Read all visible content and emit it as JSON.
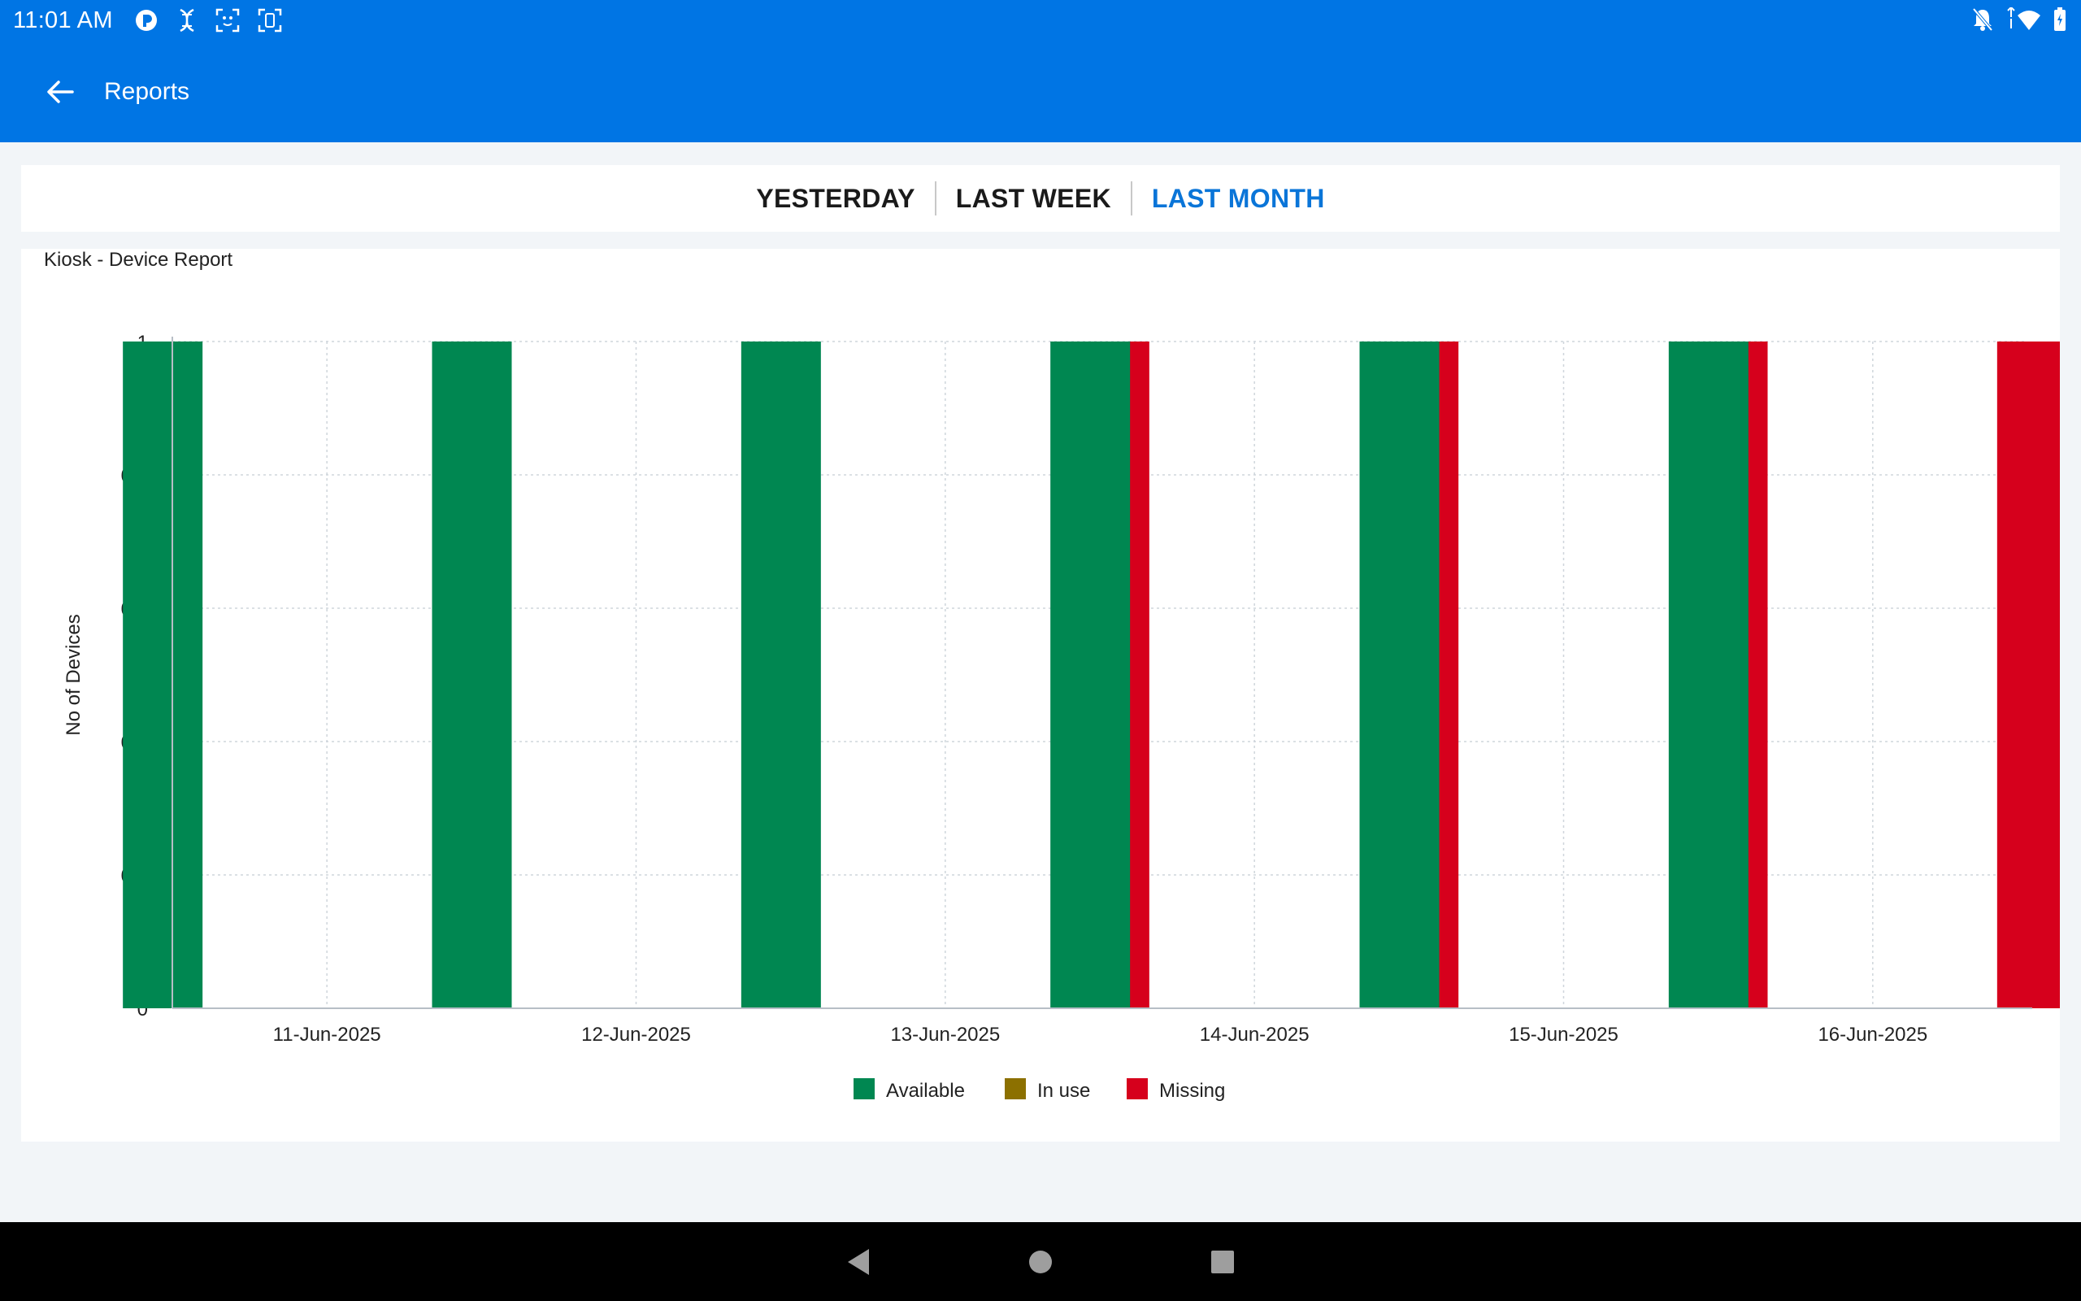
{
  "status_bar": {
    "time": "11:01 AM",
    "left_icons": [
      "app-logo-icon",
      "dna-icon",
      "face-scan-icon",
      "screenshot-icon"
    ],
    "right_icons": [
      "notifications-off-icon",
      "wifi-icon",
      "battery-icon"
    ]
  },
  "app_bar": {
    "title": "Reports",
    "back_icon": "arrow-back-icon"
  },
  "tabs": [
    {
      "label": "YESTERDAY",
      "active": false
    },
    {
      "label": "LAST WEEK",
      "active": false
    },
    {
      "label": "LAST MONTH",
      "active": true
    }
  ],
  "colors": {
    "primary": "#0075e4",
    "available": "#008751",
    "in_use": "#8c7000",
    "missing": "#d6001c"
  },
  "chart_data": {
    "type": "bar",
    "title": "Kiosk - Device Report",
    "xlabel": "",
    "ylabel": "No of Devices",
    "ylim": [
      0,
      1
    ],
    "yticks": [
      "0",
      "0.2",
      "0.4",
      "0.6",
      "0.8",
      "1"
    ],
    "categories": [
      "11-Jun-2025",
      "12-Jun-2025",
      "13-Jun-2025",
      "14-Jun-2025",
      "15-Jun-2025",
      "16-Jun-2025"
    ],
    "series": [
      {
        "name": "Available",
        "color": "#008751",
        "values": [
          1,
          1,
          1,
          1,
          1,
          1
        ]
      },
      {
        "name": "In use",
        "color": "#8c7000",
        "values": [
          0,
          0,
          0,
          0,
          0,
          0
        ]
      },
      {
        "name": "Missing",
        "color": "#d6001c",
        "values": [
          0,
          0,
          1,
          1,
          1,
          1
        ]
      }
    ],
    "grid": true,
    "legend": "bottom-center"
  },
  "nav_bar": {
    "buttons": [
      "back-triangle-icon",
      "home-circle-icon",
      "recents-square-icon"
    ]
  }
}
